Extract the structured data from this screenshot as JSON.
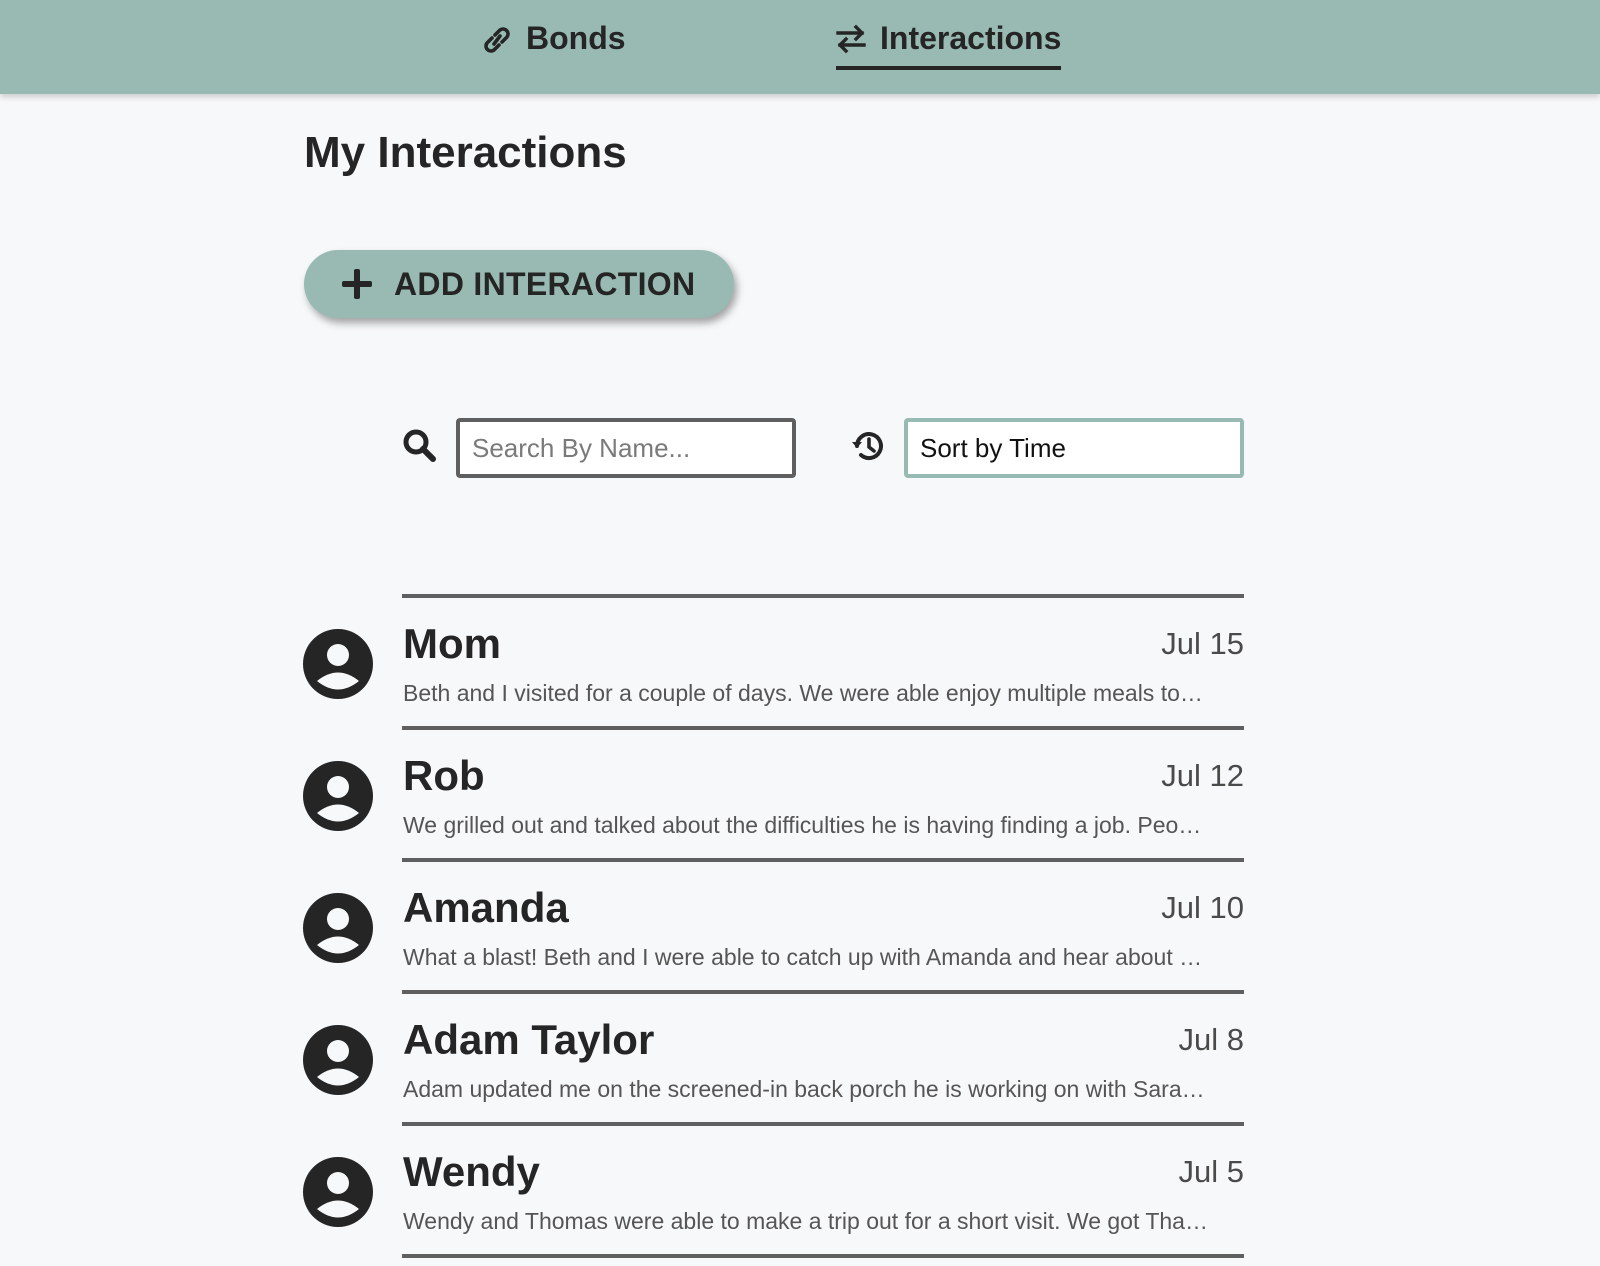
{
  "nav": {
    "items": [
      {
        "label": "Bonds",
        "icon": "link-icon",
        "active": false
      },
      {
        "label": "Interactions",
        "icon": "swap-arrows-icon",
        "active": true
      }
    ]
  },
  "page": {
    "title": "My Interactions"
  },
  "actions": {
    "add_label": "ADD INTERACTION"
  },
  "filters": {
    "search_placeholder": "Search By Name...",
    "search_value": "",
    "sort_value": "Sort by Time"
  },
  "interactions": [
    {
      "name": "Mom",
      "date": "Jul 15",
      "preview": "Beth and I visited for a couple of days. We were able enjoy multiple meals to…"
    },
    {
      "name": "Rob",
      "date": "Jul 12",
      "preview": "We grilled out and talked about the difficulties he is having finding a job. Peo…"
    },
    {
      "name": "Amanda",
      "date": "Jul 10",
      "preview": "What a blast! Beth and I were able to catch up with Amanda and hear about …"
    },
    {
      "name": "Adam Taylor",
      "date": "Jul 8",
      "preview": "Adam updated me on the screened-in back porch he is working on with Sara…"
    },
    {
      "name": "Wendy",
      "date": "Jul 5",
      "preview": "Wendy and Thomas were able to make a trip out for a short visit. We got Tha…"
    }
  ],
  "colors": {
    "accent": "#98bab3",
    "text": "#252525",
    "background": "#f7f8fa",
    "divider": "#5f5f5f"
  }
}
